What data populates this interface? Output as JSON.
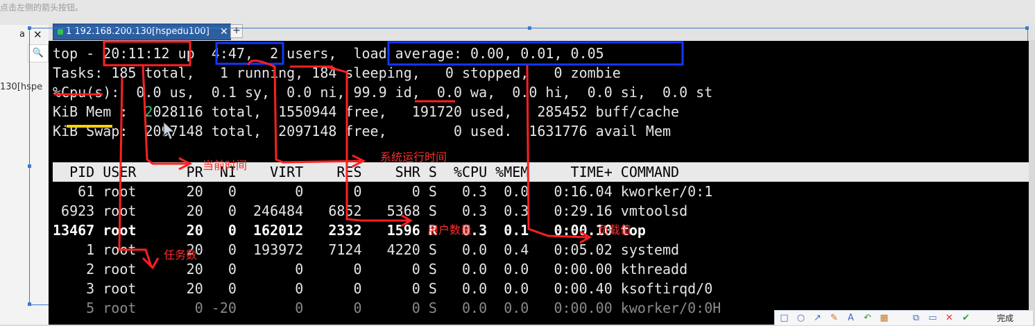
{
  "hint_text": "点击左侧的箭头按钮。",
  "left_panel": {
    "tab_letter": "a",
    "tab_close": "✕",
    "search_glyph": "🔍",
    "host_fragment": "130[hspe"
  },
  "tab": {
    "title": "1 192.168.200.130[hspedu100]",
    "close": "✕",
    "new": "+"
  },
  "terminal": {
    "line1": "top - 20:11:12 up  4:47,  2 users,  load average: 0.00, 0.01, 0.05",
    "line2": "Tasks: 185 total,   1 running, 184 sleeping,   0 stopped,   0 zombie",
    "line3": "%Cpu(s):  0.0 us,  0.1 sy,  0.0 ni, 99.9 id,  0.0 wa,  0.0 hi,  0.0 si,  0.0 st",
    "line4_a": "KiB Mem :  ",
    "line4_green": "2",
    "line4_b": "028116 total,  1550944 free,   191720 used,   285452 buff/cache",
    "line5": "KiB Swap:  2097148 total,  2097148 free,        0 used.  1631776 avail Mem",
    "header": "  PID USER      PR  NI    VIRT    RES    SHR S  %CPU %MEM     TIME+ COMMAND",
    "rows": [
      "   61 root      20   0       0      0      0 S   0.3  0.0   0:16.04 kworker/0:1",
      " 6923 root      20   0  246484   6852   5368 S   0.3  0.3   0:29.16 vmtoolsd",
      "13467 root      20   0  162012   2332   1596 R   0.3  0.1   0:00.10 top",
      "    1 root      20   0  193972   7124   4220 S   0.0  0.4   0:05.02 systemd",
      "    2 root      20   0       0      0      0 S   0.0  0.0   0:00.00 kthreadd",
      "    3 root      20   0       0      0      0 S   0.0  0.0   0:00.40 ksoftirqd/0",
      "    5 root       0 -20       0      0      0 S   0.0  0.0   0:00.00 kworker/0:0H"
    ]
  },
  "annotations": {
    "current_time": "当前时间",
    "uptime": "系统运行时间",
    "tasks": "任务数",
    "user_cpu": "用户数量",
    "load": "负载值"
  },
  "toolbar": {
    "done_label": "完成"
  },
  "colors": {
    "red": "#ff2020",
    "blue": "#1436ff",
    "yellow": "#ffd400",
    "tab": "#2d5fa0"
  }
}
